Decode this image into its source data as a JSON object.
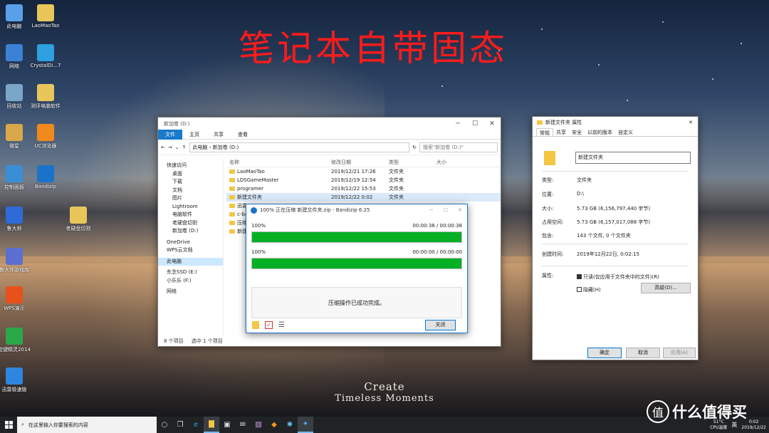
{
  "headline": "笔记本自带固态",
  "wallpaper_caption": [
    "Create",
    "Timeless Moments"
  ],
  "desktop_icons": [
    {
      "label": "此电脑",
      "icon": "computer-icon",
      "color": "#5aa0e8"
    },
    {
      "label": "LaoMaoTao",
      "icon": "folder-icon",
      "color": "#e8c65a"
    },
    {
      "label": "网络",
      "icon": "network-icon",
      "color": "#3b82d6"
    },
    {
      "label": "CrystalDi...7",
      "icon": "crystal-disk-icon",
      "color": "#2e9fe0"
    },
    {
      "label": "回收站",
      "icon": "recycle-bin-icon",
      "color": "#7aa6c8"
    },
    {
      "label": "测评电脑软件",
      "icon": "folder-icon",
      "color": "#e8c65a"
    },
    {
      "label": "微星",
      "icon": "folder-icon",
      "color": "#d8a84a"
    },
    {
      "label": "UC浏览器",
      "icon": "uc-browser-icon",
      "color": "#f08a1c"
    },
    {
      "label": "控制面板",
      "icon": "control-panel-icon",
      "color": "#3a8ed6"
    },
    {
      "label": "Bandizip",
      "icon": "bandizip-icon",
      "color": "#1a73c8"
    },
    {
      "label": "鲁大师",
      "icon": "ludashi-icon",
      "color": "#2f6bd8"
    },
    {
      "label": "老硬盘切割",
      "icon": "folder-icon",
      "color": "#e8c65a"
    },
    {
      "label": "鲁大师游戏库",
      "icon": "game-library-icon",
      "color": "#5a6fd0"
    },
    {
      "label": "WPS演示",
      "icon": "wps-presentation-icon",
      "color": "#e8501c"
    },
    {
      "label": "控键精灵2014",
      "icon": "key-sprite-icon",
      "color": "#2ba84a"
    },
    {
      "label": "迅雷极速版",
      "icon": "thunder-icon",
      "color": "#2f86e0"
    }
  ],
  "explorer": {
    "title_path": "新加卷 (D:)",
    "tabs": [
      "文件",
      "主页",
      "共享",
      "查看"
    ],
    "breadcrumb": [
      "此电脑",
      "新加卷 (D:)"
    ],
    "search_placeholder": "搜索\"新加卷 (D:)\"",
    "nav_items": [
      "快速访问",
      "桌面",
      "下载",
      "文档",
      "图片",
      "Lightroom",
      "电脑软件",
      "老硬盘切割",
      "新加卷 (D:)",
      "OneDrive",
      "WPS云文档",
      "此电脑",
      "东芝SSD (E:)",
      "小乐乐 (F:)",
      "网络"
    ],
    "columns": [
      "名称",
      "修改日期",
      "类型",
      "大小"
    ],
    "rows": [
      {
        "name": "LaoMaoTao",
        "date": "2019/12/21 17:26",
        "type": "文件夹",
        "size": ""
      },
      {
        "name": "LDSGameMaster",
        "date": "2019/12/19 12:54",
        "type": "文件夹",
        "size": ""
      },
      {
        "name": "programer",
        "date": "2019/12/22 15:53",
        "type": "文件夹",
        "size": ""
      },
      {
        "name": "新建文件夹",
        "date": "2019/12/22 0:02",
        "type": "文件夹",
        "size": ""
      },
      {
        "name": "迅雷",
        "date": "",
        "type": "",
        "size": ""
      },
      {
        "name": "c-ba",
        "date": "",
        "type": "",
        "size": ""
      },
      {
        "name": "压缩",
        "date": "",
        "type": "",
        "size": ""
      },
      {
        "name": "新建",
        "date": "",
        "type": "",
        "size": ""
      }
    ],
    "status": [
      "8 个项目",
      "选中 1 个项目"
    ]
  },
  "bandizip": {
    "title": "100% 正在压缩 新建文件夹.zip - Bandizip 6.25",
    "progress1": {
      "label": "100%",
      "time": "00:00:38 / 00:00:38",
      "value": 1.0
    },
    "progress2": {
      "label": "100%",
      "time": "00:00:00 / 00:00:00",
      "value": 1.0
    },
    "message": "压缩操作已成功完成。",
    "close_label": "关闭"
  },
  "props": {
    "title": "新建文件夹 属性",
    "tabs": [
      "常规",
      "共享",
      "安全",
      "以前的版本",
      "自定义"
    ],
    "name_value": "新建文件夹",
    "rows": [
      {
        "label": "类型:",
        "value": "文件夹"
      },
      {
        "label": "位置:",
        "value": "D:\\"
      },
      {
        "label": "大小:",
        "value": "5.73 GB (6,156,797,440 字节)"
      },
      {
        "label": "占用空间:",
        "value": "5.73 GB (6,157,017,088 字节)"
      },
      {
        "label": "包含:",
        "value": "143 个文件, 0 个文件夹"
      },
      {
        "label": "创建时间:",
        "value": "2019年12月22日, 0:02:15"
      },
      {
        "label": "属性:",
        "value": ""
      }
    ],
    "readonly_label": "只读(仅应用于文件夹中的文件)(R)",
    "hidden_label": "隐藏(H)",
    "advanced_label": "高级(D)...",
    "ok_label": "确定",
    "cancel_label": "取消",
    "apply_label": "应用(A)"
  },
  "taskbar": {
    "search_placeholder": "在这里输入你要搜索的内容",
    "temp": "51°C",
    "temp_label": "CPU温度",
    "ime": "英",
    "time": "0:02",
    "date": "2019/12/22"
  },
  "watermark": {
    "logo": "值",
    "text": "什么值得买"
  }
}
